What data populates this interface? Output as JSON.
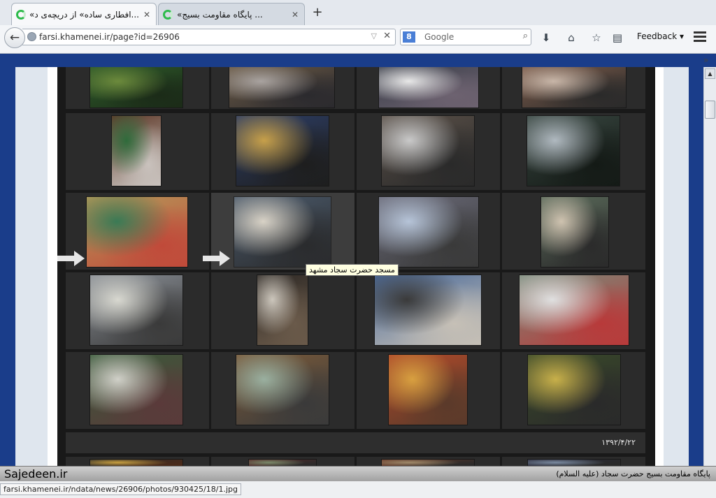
{
  "tabs": [
    {
      "title": "...افطاری ساده» از دریچه‌ی د»",
      "state": "loading",
      "active": true
    },
    {
      "title": "... پایگاه مقاومت بسیج»",
      "state": "loading",
      "active": false
    }
  ],
  "newtab_label": "+",
  "close_label": "✕",
  "toolbar": {
    "back_label": "←",
    "url": "farsi.khamenei.ir/page?id=26906",
    "search_engine": "Google",
    "search_placeholder": "Google",
    "feedback_label": "Feedback",
    "overflow_label": "»"
  },
  "gallery": {
    "date_label": "۱۳۹۲/۴/۲۲",
    "tooltip": "مسجد حضرت سجاد مشهد",
    "hover_cell": "r3c2"
  },
  "watermark": {
    "left_text": "Sajedeen.ir",
    "right_text": "پایگاه مقاومت بسیج حضرت سجاد (علیه السلام)"
  },
  "status": {
    "url": "farsi.khamenei.ir/ndata/news/26906/photos/930425/18/1.jpg"
  },
  "colors": {
    "page_background": "#1a3d8a",
    "gallery_background": "#191919",
    "cell_background": "#2b2b2b",
    "loading_spinner": "#2dbb4b",
    "tooltip_background": "#ffffe1"
  },
  "icons": [
    "globe-icon",
    "dropdown-icon",
    "stop-icon",
    "google-icon",
    "search-icon",
    "download-icon",
    "home-icon",
    "bookmark-star-icon",
    "reading-list-icon",
    "menu-icon",
    "arrow-right-icon"
  ]
}
